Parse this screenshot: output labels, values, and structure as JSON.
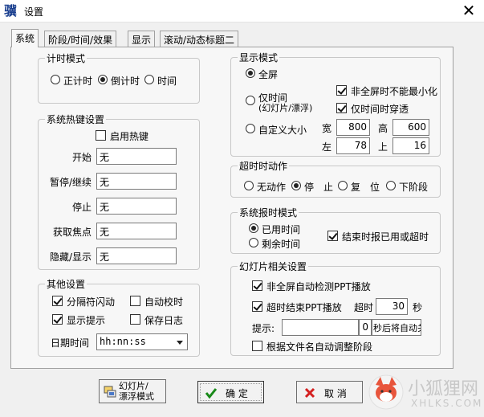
{
  "window": {
    "title": "设置",
    "app_icon_glyph": "骥",
    "close_glyph": "✕"
  },
  "tabs": [
    {
      "label": "系统",
      "active": true
    },
    {
      "label": "阶段/时间/效果",
      "active": false
    },
    {
      "label": "显示",
      "active": false
    },
    {
      "label": "滚动/动态标题二",
      "active": false
    }
  ],
  "timer_mode": {
    "legend": "计时模式",
    "options": [
      {
        "label": "正计时",
        "selected": false
      },
      {
        "label": "倒计时",
        "selected": true
      },
      {
        "label": "时间",
        "selected": false
      }
    ]
  },
  "hotkeys": {
    "legend": "系统热键设置",
    "enable_label": "启用热键",
    "enabled": false,
    "rows": [
      {
        "label": "开始",
        "value": "无"
      },
      {
        "label": "暂停/继续",
        "value": "无"
      },
      {
        "label": "停止",
        "value": "无"
      },
      {
        "label": "获取焦点",
        "value": "无"
      },
      {
        "label": "隐藏/显示",
        "value": "无"
      }
    ]
  },
  "other": {
    "legend": "其他设置",
    "separator_blink": {
      "label": "分隔符闪动",
      "checked": true
    },
    "auto_sync": {
      "label": "自动校时",
      "checked": false
    },
    "show_tips": {
      "label": "显示提示",
      "checked": true
    },
    "save_log": {
      "label": "保存日志",
      "checked": false
    },
    "date_time_label": "日期时间",
    "date_time_format": "hh:nn:ss"
  },
  "display_mode": {
    "legend": "显示模式",
    "fullscreen": {
      "label": "全屏",
      "selected": true
    },
    "time_only": {
      "label": "仅时间",
      "sub_label": "(幻灯片/漂浮)",
      "selected": false
    },
    "custom": {
      "label": "自定义大小",
      "selected": false
    },
    "no_minimize": {
      "label": "非全屏时不能最小化",
      "checked": true
    },
    "time_passthrough": {
      "label": "仅时间时穿透",
      "checked": true
    },
    "width": {
      "label": "宽",
      "value": "800"
    },
    "height": {
      "label": "高",
      "value": "600"
    },
    "left": {
      "label": "左",
      "value": "78"
    },
    "top": {
      "label": "上",
      "value": "16"
    }
  },
  "timeout_action": {
    "legend": "超时时动作",
    "options": [
      {
        "label": "无动作",
        "selected": false
      },
      {
        "label": "停　止",
        "selected": true
      },
      {
        "label": "复　位",
        "selected": false
      },
      {
        "label": "下阶段",
        "selected": false
      }
    ]
  },
  "report_mode": {
    "legend": "系统报时模式",
    "used": {
      "label": "已用时间",
      "selected": true
    },
    "remaining": {
      "label": "剩余时间",
      "selected": false
    },
    "end_report": {
      "label": "结束时报已用或超时",
      "checked": true
    }
  },
  "slides": {
    "legend": "幻灯片相关设置",
    "auto_detect": {
      "label": "非全屏自动检测PPT播放",
      "checked": true
    },
    "timeout_end": {
      "label": "超时结束PPT播放",
      "checked": true
    },
    "timeout_label": "超时",
    "timeout_value": "30",
    "timeout_unit": "秒",
    "prompt_label": "提示:",
    "prompt_value": "",
    "close_seconds": "0",
    "close_suffix": "秒后将自动关",
    "filename_adjust": {
      "label": "根据文件名自动调整阶段",
      "checked": false
    }
  },
  "buttons": {
    "slide_mode_line1": "幻灯片/",
    "slide_mode_line2": "漂浮模式",
    "ok": "确 定",
    "cancel": "取 消"
  },
  "watermark": {
    "name": "小狐狸网",
    "url": "XHLKS.COM"
  },
  "colors": {
    "ok_check": "#1a8a1a",
    "cancel_x": "#d42020",
    "fox_accent": "#e8553c"
  }
}
